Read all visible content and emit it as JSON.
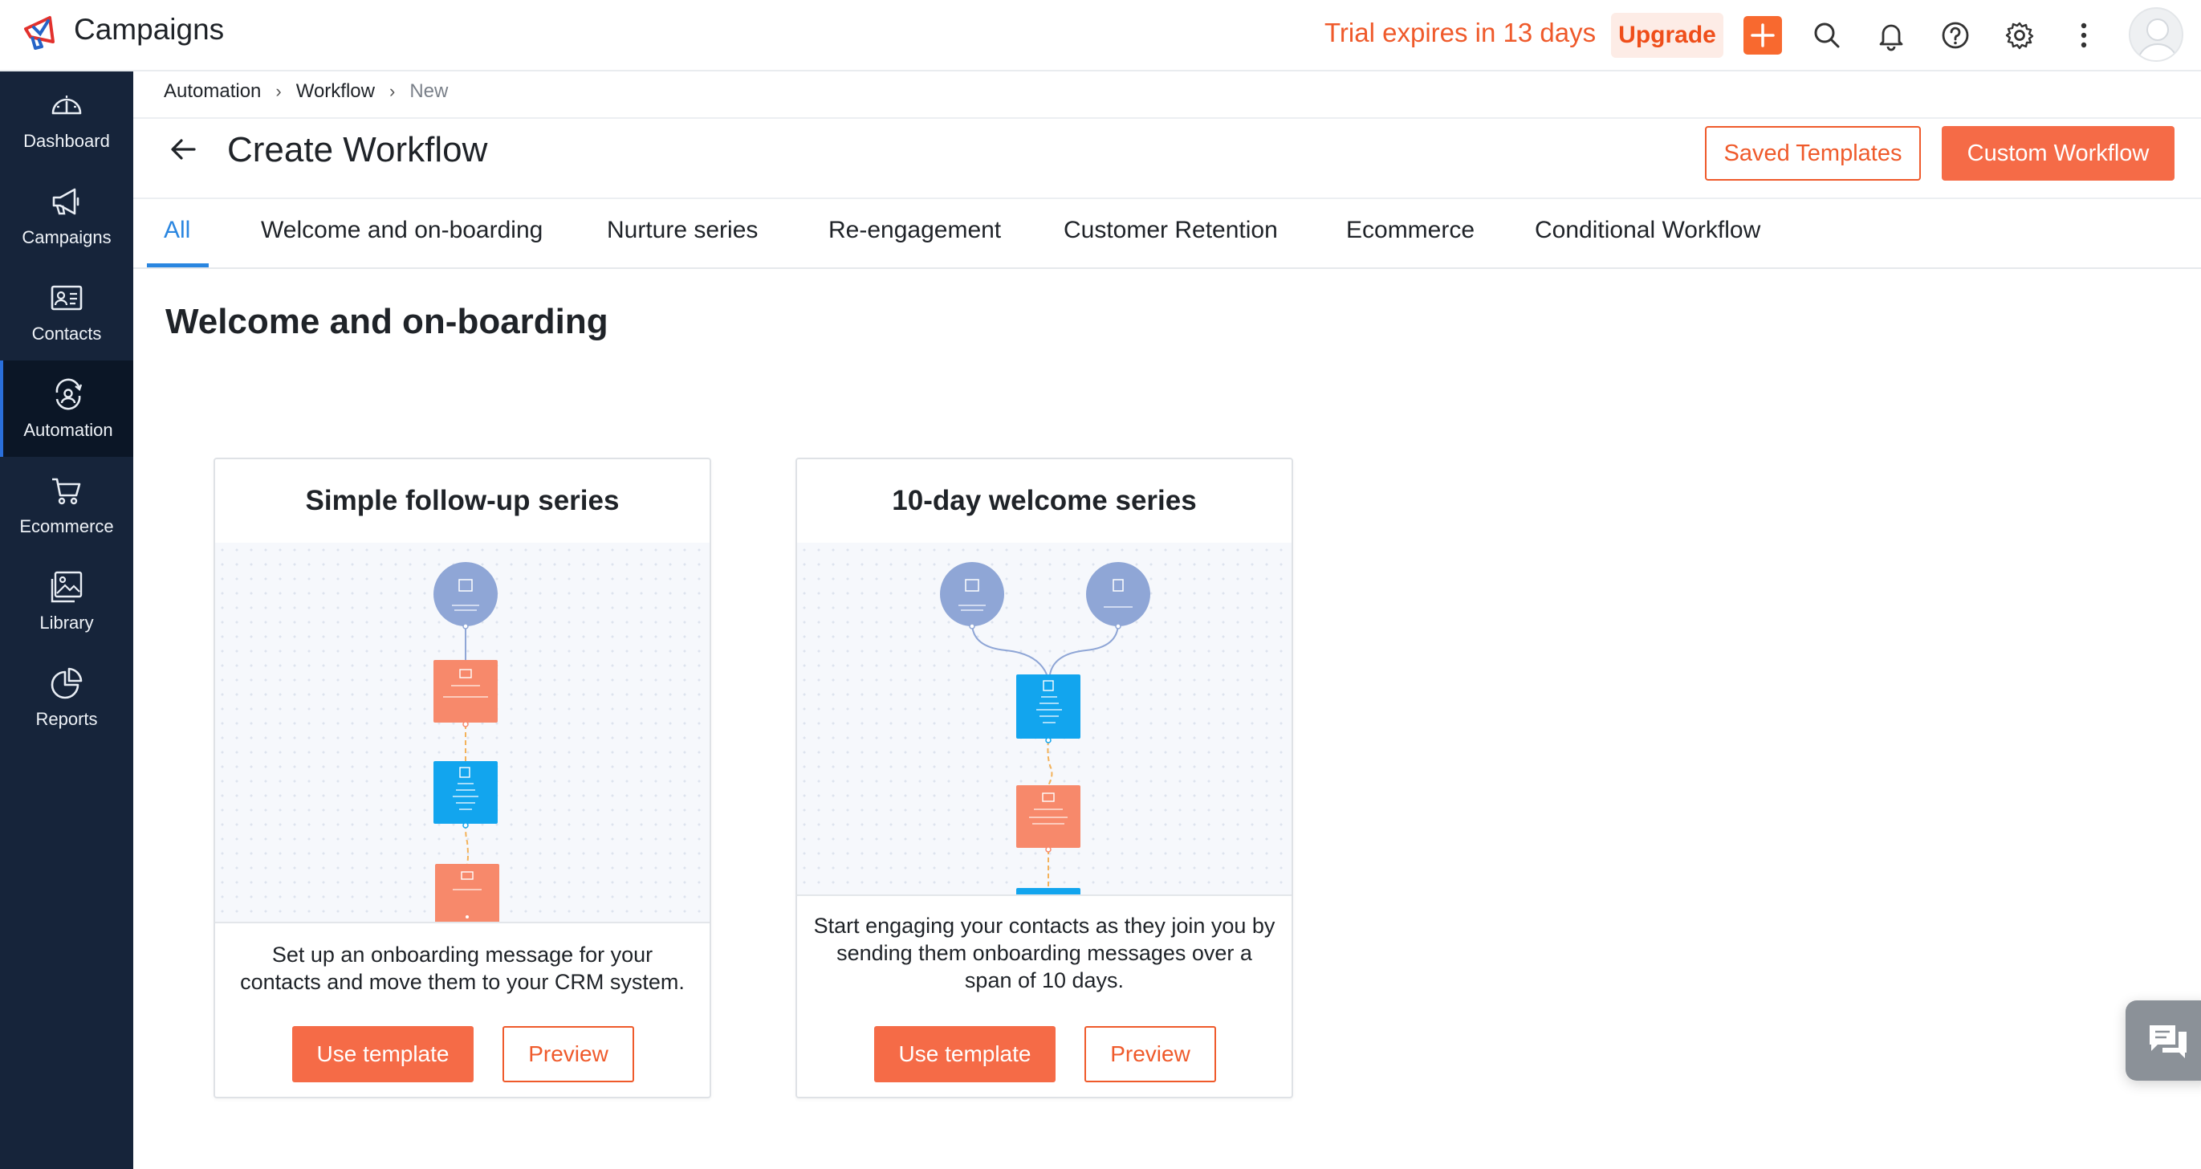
{
  "header": {
    "app_name": "Campaigns",
    "trial_text": "Trial expires in 13 days",
    "upgrade_label": "Upgrade"
  },
  "sidebar": {
    "items": [
      {
        "label": "Dashboard",
        "icon": "dashboard-gauge-icon"
      },
      {
        "label": "Campaigns",
        "icon": "megaphone-icon"
      },
      {
        "label": "Contacts",
        "icon": "contact-card-icon"
      },
      {
        "label": "Automation",
        "icon": "automation-icon"
      },
      {
        "label": "Ecommerce",
        "icon": "cart-icon"
      },
      {
        "label": "Library",
        "icon": "image-library-icon"
      },
      {
        "label": "Reports",
        "icon": "pie-chart-icon"
      }
    ],
    "active": "Automation"
  },
  "breadcrumb": {
    "items": [
      "Automation",
      "Workflow"
    ],
    "current": "New"
  },
  "page": {
    "title": "Create Workflow",
    "saved_templates_label": "Saved Templates",
    "custom_workflow_label": "Custom Workflow"
  },
  "tabs": [
    "All",
    "Welcome and on-boarding",
    "Nurture series",
    "Re-engagement",
    "Customer Retention",
    "Ecommerce",
    "Conditional Workflow"
  ],
  "active_tab": "All",
  "section": {
    "title": "Welcome and on-boarding"
  },
  "cards": [
    {
      "title": "Simple follow-up series",
      "description": "Set up an onboarding message for your contacts and move them to your CRM system.",
      "use_label": "Use template",
      "preview_label": "Preview"
    },
    {
      "title": "10-day welcome series",
      "description": "Start engaging your contacts as they join you by sending them onboarding messages over a span of 10 days.",
      "use_label": "Use template",
      "preview_label": "Preview"
    }
  ],
  "colors": {
    "accent": "#f56b47",
    "accent_text": "#ef5a2b",
    "tab_active": "#2a86e0",
    "sidebar_bg": "#16243a",
    "node_trigger": "#8fa6d6",
    "node_message": "#f7896b",
    "node_wait": "#12a5ee"
  }
}
